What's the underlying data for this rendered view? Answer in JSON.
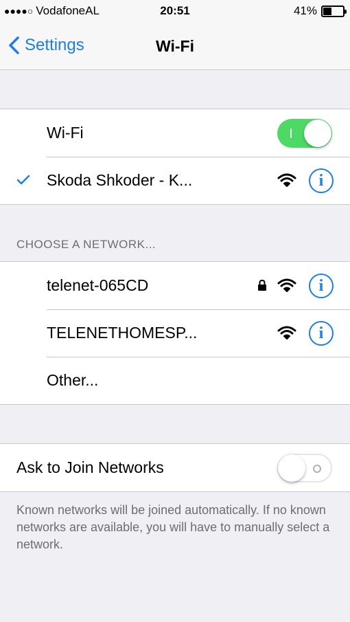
{
  "status": {
    "signal_dots": "●●●●○",
    "carrier": "VodafoneAL",
    "time": "20:51",
    "battery": "41%",
    "battery_level": 0.41
  },
  "nav": {
    "back_label": "Settings",
    "title": "Wi-Fi"
  },
  "wifi": {
    "label": "Wi-Fi",
    "enabled": true,
    "connected_network": "Skoda Shkoder - K..."
  },
  "choose": {
    "header": "CHOOSE A NETWORK...",
    "networks": [
      {
        "name": "telenet-065CD",
        "locked": true
      },
      {
        "name": "TELENETHOMESP...",
        "locked": false
      }
    ],
    "other": "Other..."
  },
  "ask_join": {
    "label": "Ask to Join Networks",
    "enabled": false,
    "footer": "Known networks will be joined automatically. If no known networks are available, you will have to manually select a network."
  },
  "colors": {
    "accent": "#1a7ef2",
    "toggle_on": "#4cd964"
  },
  "icons": {
    "back": "chevron-left-icon",
    "check": "checkmark-icon",
    "wifi": "wifi-signal-icon",
    "lock": "lock-icon",
    "info": "info-icon"
  }
}
